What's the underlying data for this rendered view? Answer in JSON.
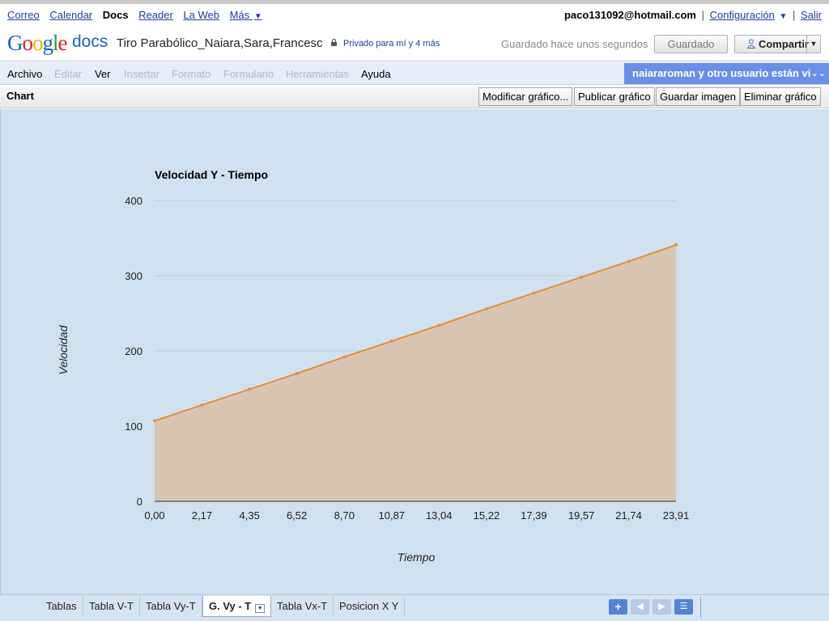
{
  "nav": {
    "links": [
      "Correo",
      "Calendar",
      "Docs",
      "Reader",
      "La Web",
      "Más"
    ],
    "active": "Docs",
    "user_email": "paco131092@hotmail.com",
    "settings": "Configuración",
    "signout": "Salir"
  },
  "header": {
    "doc_title": "Tiro Parabólico_Naiara,Sara,Francesc",
    "privacy": "Privado para mí y 4 más",
    "save_status": "Guardado hace unos segundos",
    "saved_button": "Guardado",
    "share_button": "Compartir"
  },
  "menu": {
    "items": [
      {
        "label": "Archivo",
        "enabled": true
      },
      {
        "label": "Editar",
        "enabled": false
      },
      {
        "label": "Ver",
        "enabled": true
      },
      {
        "label": "Insertar",
        "enabled": false
      },
      {
        "label": "Formato",
        "enabled": false
      },
      {
        "label": "Formulario",
        "enabled": false
      },
      {
        "label": "Herramientas",
        "enabled": false
      },
      {
        "label": "Ayuda",
        "enabled": true
      }
    ],
    "collaborators": "naiararoman y otro usuario están vi"
  },
  "chart_toolbar": {
    "label": "Chart",
    "buttons": [
      "Modificar gráfico...",
      "Publicar gráfico",
      "Guardar imagen",
      "Eliminar gráfico"
    ]
  },
  "chart_data": {
    "type": "area",
    "title": "Velocidad Y - Tiempo",
    "xlabel": "Tiempo",
    "ylabel": "Velocidad",
    "x": [
      0.0,
      2.17,
      4.35,
      6.52,
      8.7,
      10.87,
      13.04,
      15.22,
      17.39,
      19.57,
      21.74,
      23.91
    ],
    "x_tick_labels": [
      "0,00",
      "2,17",
      "4,35",
      "6,52",
      "8,70",
      "10,87",
      "13,04",
      "15,22",
      "17,39",
      "19,57",
      "21,74",
      "23,91"
    ],
    "series": [
      {
        "values": [
          107,
          128,
          149,
          170,
          192,
          213,
          234,
          256,
          277,
          298,
          319,
          341
        ]
      }
    ],
    "ylim": [
      0,
      400
    ],
    "yticks": [
      0,
      100,
      200,
      300,
      400
    ],
    "grid": true,
    "colors": {
      "line": "#e8913a",
      "fill": "#d8c6b2",
      "background": "#cfe0f0",
      "grid": "#bccddf"
    }
  },
  "sheets": {
    "tabs": [
      "Tablas",
      "Tabla V-T",
      "Tabla Vy-T",
      "G. Vy - T",
      "Tabla Vx-T",
      "Posicion X Y"
    ],
    "active": "G. Vy - T"
  }
}
